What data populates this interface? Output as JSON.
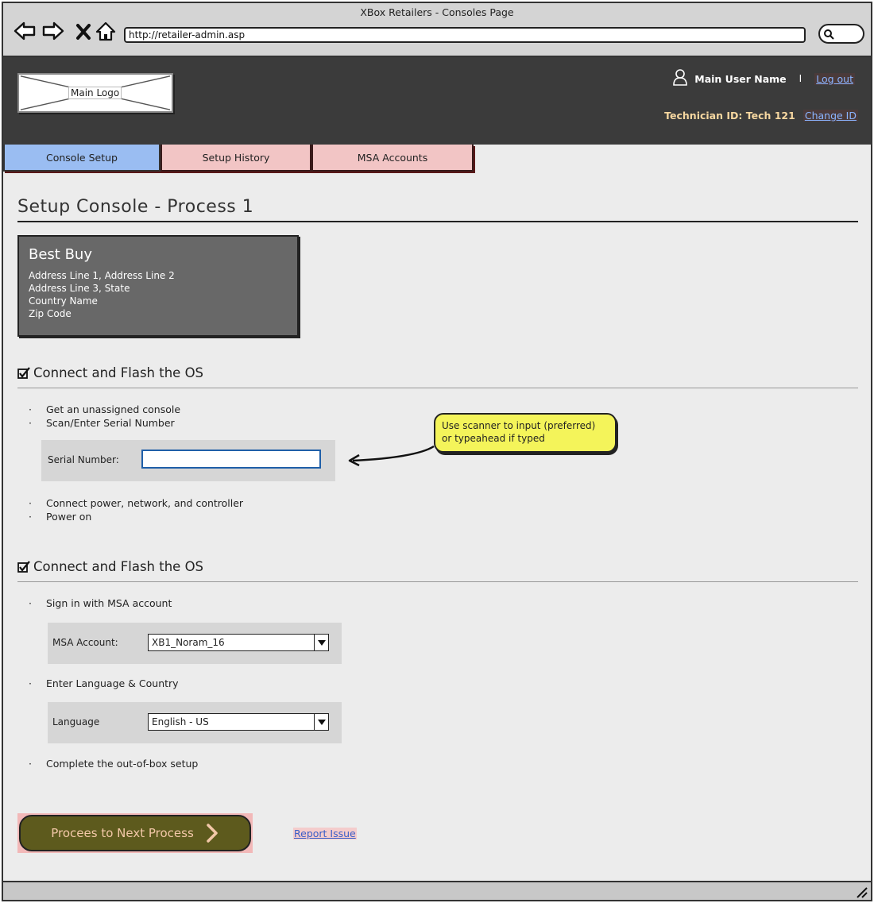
{
  "window": {
    "title": "XBox Retailers - Consoles Page"
  },
  "browser": {
    "url": "http://retailer-admin.asp"
  },
  "header": {
    "logo_label": "Main Logo",
    "user_name": "Main User Name",
    "separator": "I",
    "logout_label": "Log out",
    "technician_text": "Technician ID: Tech 121",
    "change_id_label": "Change ID"
  },
  "tabs": [
    {
      "label": "Console Setup",
      "active": true
    },
    {
      "label": "Setup History",
      "active": false
    },
    {
      "label": "MSA Accounts",
      "active": false
    }
  ],
  "page": {
    "title": "Setup Console - Process 1"
  },
  "store": {
    "name": "Best Buy",
    "lines": [
      "Address Line 1, Address Line 2",
      "Address Line 3, State",
      "Country Name",
      "Zip Code"
    ]
  },
  "section1": {
    "title": "Connect and Flash the OS",
    "bullets_top": [
      "Get an unassigned console",
      "Scan/Enter Serial Number"
    ],
    "serial_label": "Serial Number:",
    "serial_value": "",
    "bullets_bottom": [
      "Connect power, network, and controller",
      "Power on"
    ]
  },
  "callout": {
    "line1": "Use scanner to input (preferred)",
    "line2": "or typeahead if typed"
  },
  "section2": {
    "title": "Connect and Flash the OS",
    "bullet_msa": "Sign in with MSA account",
    "msa_label": "MSA Account:",
    "msa_value": "XB1_Noram_16",
    "bullet_lang": "Enter Language & Country",
    "lang_label": "Language",
    "lang_value": "English - US",
    "bullet_complete": "Complete the out-of-box setup"
  },
  "actions": {
    "proceed_label": "Procees to Next Process",
    "report_label": "Report Issue"
  },
  "colors": {
    "active_tab": "#9abdf2",
    "inactive_tab": "#f2c5c5",
    "proceed_button": "#5d5a1d",
    "callout": "#f4f45a"
  }
}
